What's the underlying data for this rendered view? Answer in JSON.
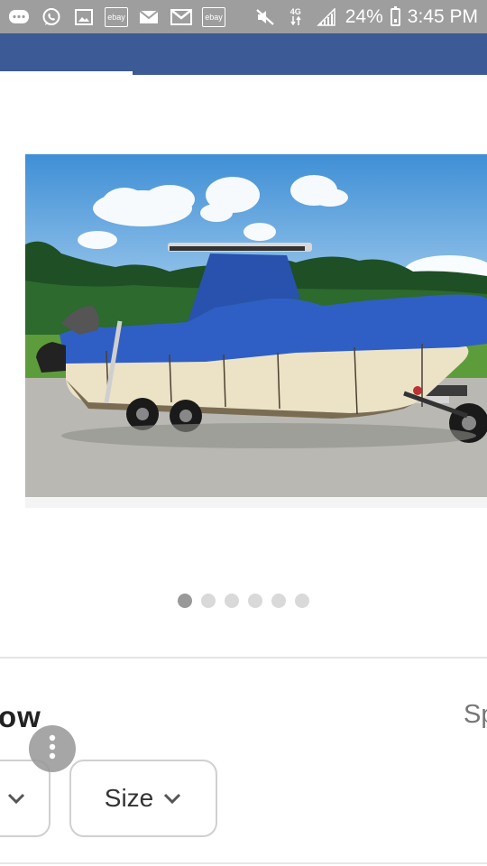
{
  "status_bar": {
    "icons": [
      "messages-icon",
      "whatsapp-icon",
      "gallery-icon",
      "ebay-icon",
      "email-icon",
      "gmail-icon",
      "ebay-icon",
      "mute-icon",
      "4g-lte-icon",
      "signal-icon",
      "battery-icon"
    ],
    "ebay_label": "ebay",
    "network_label": "4G",
    "battery": "24%",
    "time": "3:45 PM"
  },
  "carousel": {
    "image": "boat-cover-image",
    "page_count": 6,
    "active_index": 0
  },
  "product": {
    "title_fragment": "ow",
    "right_fragment": "Sp"
  },
  "filters": {
    "size_label": "Size"
  },
  "colors": {
    "status_bar": "#9e9e9e",
    "app_bar": "#3b5a96",
    "cover_blue": "#2f5fc4"
  }
}
